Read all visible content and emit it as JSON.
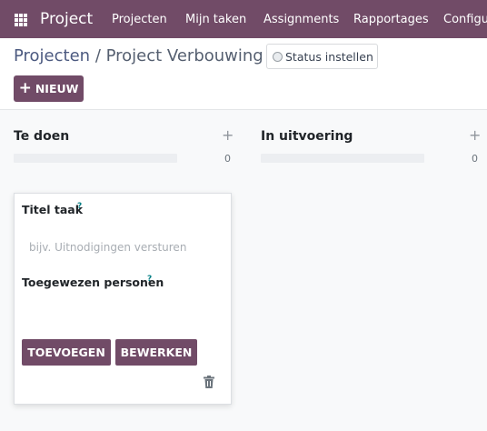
{
  "navbar": {
    "brand": "Project",
    "menu": [
      "Projecten",
      "Mijn taken",
      "Assignments",
      "Rapportages",
      "Configu"
    ]
  },
  "breadcrumb": {
    "parent": "Projecten",
    "separator": "/",
    "current": "Project Verbouwing"
  },
  "status_button": {
    "label": "Status instellen"
  },
  "new_button": {
    "label": "NIEUW"
  },
  "columns": [
    {
      "title": "Te doen",
      "count": "0"
    },
    {
      "title": "In uitvoering",
      "count": "0"
    }
  ],
  "quick_create": {
    "title_label": "Titel taak",
    "title_help": "?",
    "title_placeholder": "bijv. Uitnodigingen versturen",
    "assignees_label": "Toegewezen personen",
    "assignees_help": "?",
    "add_button": "TOEVOEGEN",
    "edit_button": "BEWERKEN"
  },
  "colors": {
    "brand": "#714b67",
    "help": "#017e84"
  },
  "icons": [
    "apps-grid-icon",
    "plus-icon",
    "radio-icon",
    "trash-icon"
  ]
}
